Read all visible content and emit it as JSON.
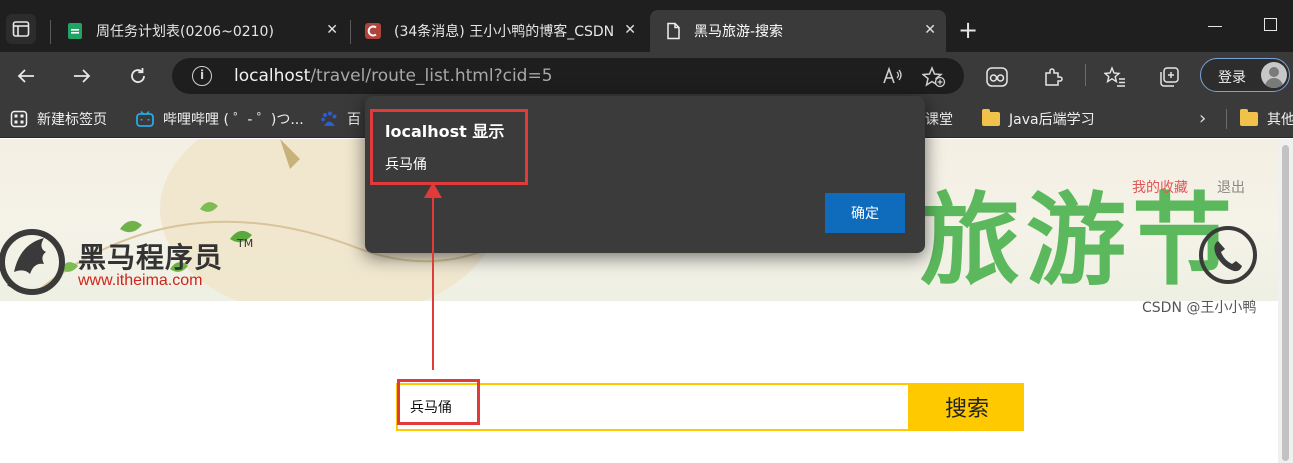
{
  "tabs": [
    {
      "title": "周任务计划表(0206~0210)",
      "close": "✕"
    },
    {
      "title": "(34条消息) 王小小鸭的博客_CSDN",
      "close": "✕"
    },
    {
      "title": "黑马旅游-搜索",
      "close": "✕"
    }
  ],
  "new_tab": "+",
  "address": {
    "host": "localhost",
    "path": "/travel/route_list.html?cid=5"
  },
  "profile": {
    "login_label": "登录"
  },
  "bookmarks": [
    {
      "label": "新建标签页"
    },
    {
      "label": "哔哩哔哩 ( ゜- ゜)つ..."
    },
    {
      "label": "百"
    },
    {
      "label": "课堂"
    },
    {
      "label": "Java后端学习"
    },
    {
      "label": "其他"
    }
  ],
  "dialog": {
    "title": "localhost 显示",
    "message": "兵马俑",
    "ok_label": "确定"
  },
  "header_links": {
    "favorites": "我的收藏",
    "logout": "退出"
  },
  "logo": {
    "name": "黑马程序员",
    "tm": "TM",
    "url": "www.itheima.com"
  },
  "search": {
    "value": "兵马俑",
    "button_label": "搜索"
  },
  "banner": {
    "headline": "旅游节"
  },
  "watermark": "CSDN @王小小鸭",
  "colors": {
    "accent_yellow": "#ffc900",
    "annotation_red": "#e03a3a",
    "link_red": "#e05656",
    "dialog_button": "#0f6cbd"
  }
}
